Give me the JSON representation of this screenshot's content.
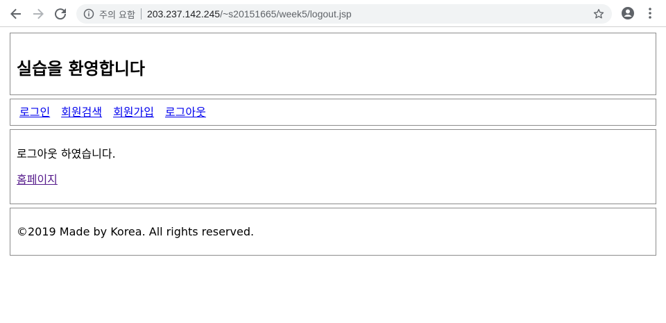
{
  "browser": {
    "security_label": "주의 요함",
    "url_host": "203.237.142.245",
    "url_path": "/~s20151665/week5/logout.jsp",
    "icons": [
      "back-icon",
      "forward-icon",
      "reload-icon",
      "info-icon",
      "star-icon",
      "profile-icon",
      "menu-icon"
    ]
  },
  "header": {
    "title": "실습을 환영합니다"
  },
  "nav": {
    "items": [
      {
        "label": "로그인"
      },
      {
        "label": "회원검색"
      },
      {
        "label": "회원가입"
      },
      {
        "label": "로그아웃"
      }
    ]
  },
  "content": {
    "message": "로그아웃 하였습니다.",
    "home_link": "홈페이지"
  },
  "footer": {
    "text": "©2019 Made by Korea. All rights reserved."
  },
  "colors": {
    "link": "#0000ee",
    "visited_link": "#551a8b",
    "border": "#8c8c8c"
  }
}
